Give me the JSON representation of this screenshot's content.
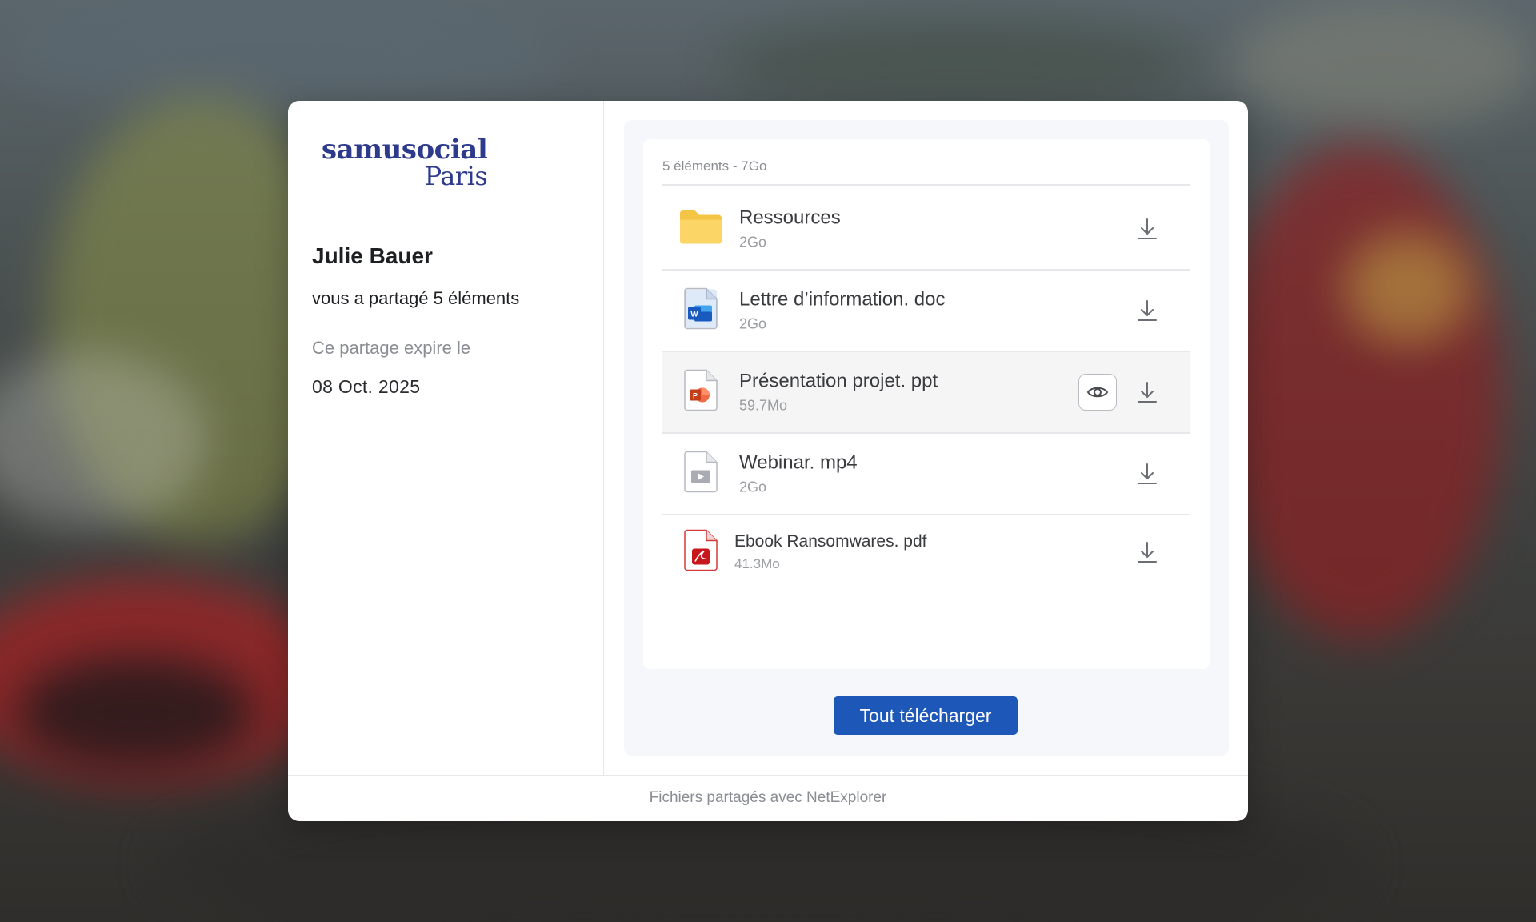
{
  "brand": {
    "logo_line1": "samusocial",
    "logo_line2": "Paris",
    "color": "#2e3a8c"
  },
  "sender": {
    "name": "Julie Bauer",
    "shared_text": "vous a partagé 5 éléments",
    "expire_label": "Ce partage expire le",
    "expire_date": "08 Oct. 2025"
  },
  "files_summary": "5 éléments - 7Go",
  "files": [
    {
      "name": "Ressources",
      "size": "2Go",
      "icon": "folder-icon"
    },
    {
      "name": "Lettre d’information. doc",
      "size": "2Go",
      "icon": "word-doc-icon"
    },
    {
      "name": "Présentation projet. ppt",
      "size": "59.7Mo",
      "icon": "powerpoint-icon",
      "highlighted": true
    },
    {
      "name": "Webinar. mp4",
      "size": "2Go",
      "icon": "video-file-icon"
    },
    {
      "name": "Ebook Ransomwares. pdf",
      "size": "41.3Mo",
      "icon": "pdf-icon"
    }
  ],
  "download_all_label": "Tout télécharger",
  "footer_text": "Fichiers partagés avec NetExplorer",
  "colors": {
    "primary_button": "#1d57b8",
    "highlight_row": "#f5f5f6"
  }
}
